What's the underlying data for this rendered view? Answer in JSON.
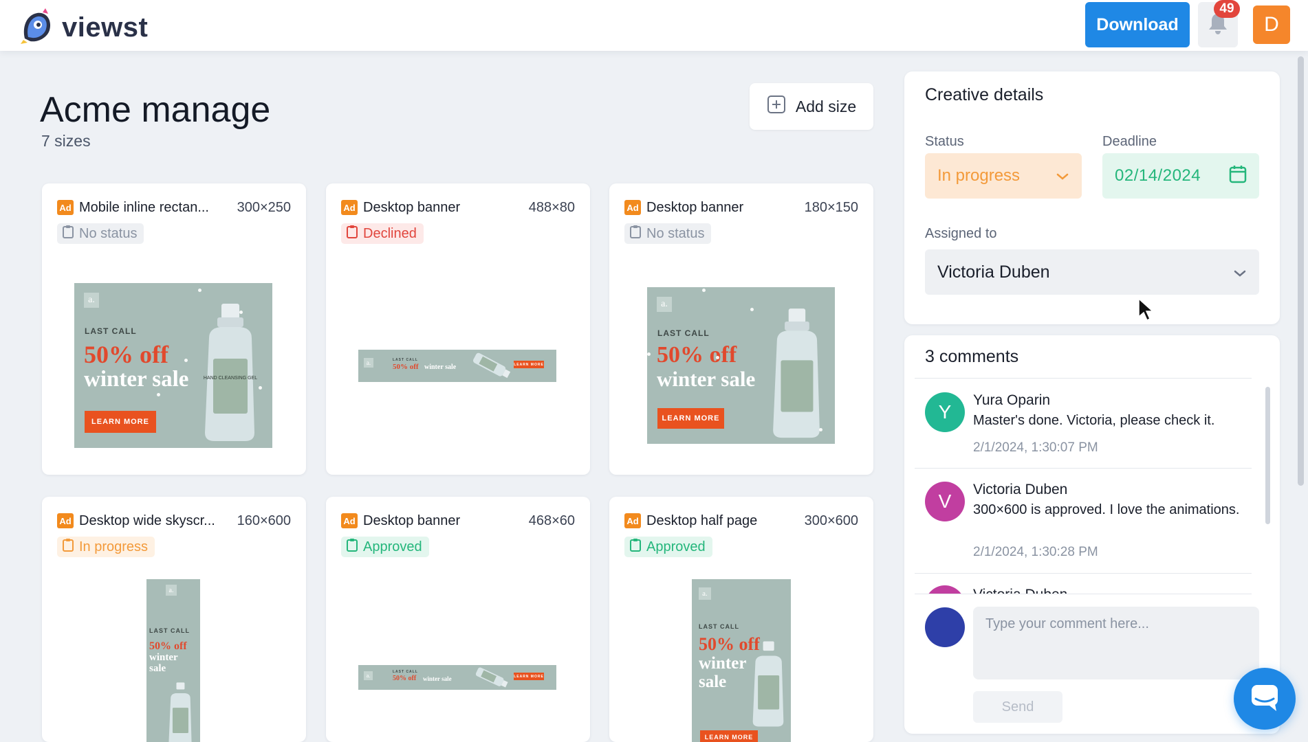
{
  "app": {
    "logo_text": "viewst"
  },
  "topbar": {
    "download_label": "Download",
    "notifications_count": "49",
    "user_initial": "D"
  },
  "header": {
    "title": "Acme manage",
    "sizes_count": "7 sizes",
    "add_size_label": "Add size"
  },
  "ad_badge": "Ad",
  "ad_art": {
    "mark": "a.",
    "last_call": "LAST CALL",
    "off": "50% off",
    "winter": "winter",
    "sale": "sale",
    "winter_sale": "winter sale",
    "learn_more": "LEARN MORE",
    "bottle_label": "HAND CLEANSING GEL"
  },
  "cards": [
    {
      "name": "Mobile inline rectan...",
      "dims": "300×250",
      "status": "No status"
    },
    {
      "name": "Desktop banner",
      "dims": "488×80",
      "status": "Declined"
    },
    {
      "name": "Desktop banner",
      "dims": "180×150",
      "status": "No status"
    },
    {
      "name": "Desktop wide skyscr...",
      "dims": "160×600",
      "status": "In progress"
    },
    {
      "name": "Desktop banner",
      "dims": "468×60",
      "status": "Approved"
    },
    {
      "name": "Desktop half page",
      "dims": "300×600",
      "status": "Approved"
    }
  ],
  "details": {
    "title": "Creative details",
    "status_label": "Status",
    "status_value": "In progress",
    "deadline_label": "Deadline",
    "deadline_value": "02/14/2024",
    "assigned_label": "Assigned to",
    "assigned_value": "Victoria Duben"
  },
  "comments": {
    "title": "3 comments",
    "items": [
      {
        "initial": "Y",
        "author": "Yura Oparin",
        "text": "Master's done. Victoria, please check it.",
        "time": "2/1/2024, 1:30:07 PM"
      },
      {
        "initial": "V",
        "author": "Victoria Duben",
        "text": "300×600 is approved. I love the animations.",
        "time": "2/1/2024, 1:30:28 PM"
      },
      {
        "initial": "V",
        "author": "Victoria Duben",
        "text": "",
        "time": ""
      }
    ],
    "input_placeholder": "Type your comment here...",
    "send_label": "Send"
  },
  "colors": {
    "accent": "#1f88e5",
    "status_in_progress": "#f39a3a",
    "status_declined": "#e1453c",
    "status_approved": "#24b67b",
    "status_none": "#8a93a2",
    "avatar_yura": "#22b894",
    "avatar_victoria": "#c13ea0"
  },
  "icons": [
    "viewst-logo-icon",
    "bell-icon",
    "plus-square-icon",
    "clipboard-icon",
    "chevron-down-icon",
    "calendar-icon",
    "chat-icon",
    "cursor-icon"
  ]
}
